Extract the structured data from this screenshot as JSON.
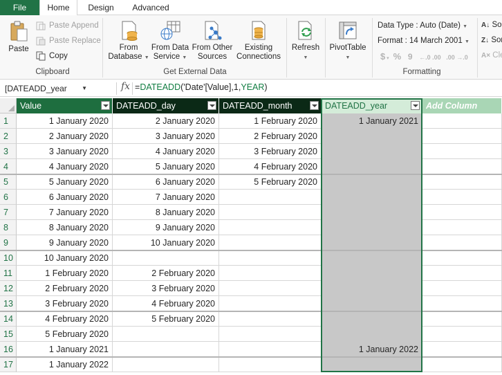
{
  "tabs": {
    "file": "File",
    "home": "Home",
    "design": "Design",
    "advanced": "Advanced"
  },
  "ribbon": {
    "clipboard": {
      "paste": "Paste",
      "paste_append": "Paste Append",
      "paste_replace": "Paste Replace",
      "copy": "Copy",
      "group_label": "Clipboard"
    },
    "external_data": {
      "from_database_1": "From",
      "from_database_2": "Database",
      "from_data_service_1": "From Data",
      "from_data_service_2": "Service",
      "from_other_sources_1": "From Other",
      "from_other_sources_2": "Sources",
      "existing_connections_1": "Existing",
      "existing_connections_2": "Connections",
      "group_label": "Get External Data"
    },
    "refresh": "Refresh",
    "pivottable": "PivotTable",
    "formatting": {
      "data_type": "Data Type : Auto (Date)",
      "format": "Format : 14 March 2001",
      "currency_symbol": "$",
      "percent_symbol": "%",
      "thousands_symbol": "9",
      "inc_decimal": "←.0 .00",
      "dec_decimal": ".00 →.0",
      "group_label": "Formatting"
    },
    "sort": {
      "sort_az": "Sor",
      "sort_za": "Sor",
      "clear": "Cle"
    }
  },
  "formula_bar": {
    "name_box": "[DATEADD_year",
    "fx": "fx",
    "formula_eq": "=",
    "formula_fn": "DATEADD",
    "formula_args": "('Date'[Value],1,",
    "formula_kw": "YEAR",
    "formula_close": ")"
  },
  "grid": {
    "columns": [
      "Value",
      "DATEADD_day",
      "DATEADD_month",
      "DATEADD_year",
      "Add Column"
    ],
    "rows": [
      {
        "n": "1",
        "cells": [
          "1 January 2020",
          "2 January 2020",
          "1 February 2020",
          "1 January 2021"
        ]
      },
      {
        "n": "2",
        "cells": [
          "2 January 2020",
          "3 January 2020",
          "2 February 2020",
          ""
        ]
      },
      {
        "n": "3",
        "cells": [
          "3 January 2020",
          "4 January 2020",
          "3 February 2020",
          ""
        ]
      },
      {
        "n": "4",
        "cells": [
          "4 January 2020",
          "5 January 2020",
          "4 February 2020",
          ""
        ]
      },
      {
        "n": "5",
        "cells": [
          "5 January 2020",
          "6 January 2020",
          "5 February 2020",
          ""
        ]
      },
      {
        "n": "6",
        "cells": [
          "6 January 2020",
          "7 January 2020",
          "",
          ""
        ]
      },
      {
        "n": "7",
        "cells": [
          "7 January 2020",
          "8 January 2020",
          "",
          ""
        ]
      },
      {
        "n": "8",
        "cells": [
          "8 January 2020",
          "9 January 2020",
          "",
          ""
        ]
      },
      {
        "n": "9",
        "cells": [
          "9 January 2020",
          "10 January 2020",
          "",
          ""
        ]
      },
      {
        "n": "10",
        "cells": [
          "10 January 2020",
          "",
          "",
          ""
        ]
      },
      {
        "n": "11",
        "cells": [
          "1 February 2020",
          "2 February 2020",
          "",
          ""
        ]
      },
      {
        "n": "12",
        "cells": [
          "2 February 2020",
          "3 February 2020",
          "",
          ""
        ]
      },
      {
        "n": "13",
        "cells": [
          "3 February 2020",
          "4 February 2020",
          "",
          ""
        ]
      },
      {
        "n": "14",
        "cells": [
          "4 February 2020",
          "5 February 2020",
          "",
          ""
        ]
      },
      {
        "n": "15",
        "cells": [
          "5 February 2020",
          "",
          "",
          ""
        ]
      },
      {
        "n": "16",
        "cells": [
          "1 January 2021",
          "",
          "",
          "1 January 2022"
        ]
      },
      {
        "n": "17",
        "cells": [
          "1 January 2022",
          "",
          "",
          ""
        ]
      }
    ],
    "colors": {
      "header_dark": "#1e6e3f",
      "header_darkest": "#0b2916",
      "selected_header": "#d4ecd9",
      "add_column": "#a9d6b5",
      "accent": "#217346",
      "selected_column": "#c8c8c8"
    }
  }
}
